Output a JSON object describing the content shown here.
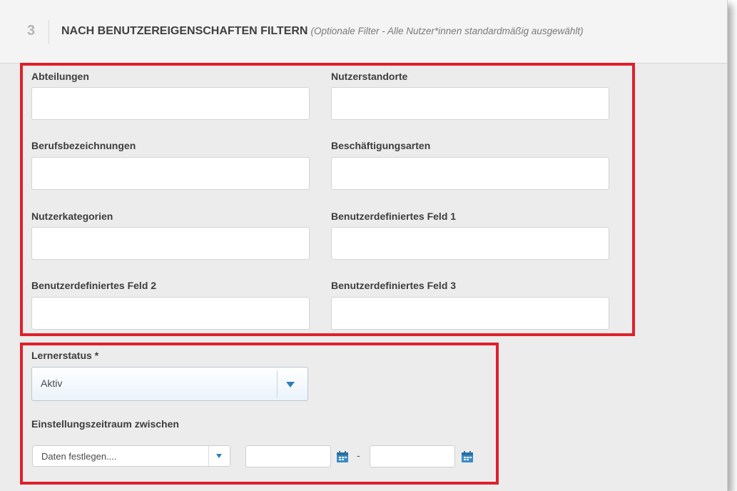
{
  "header": {
    "step_number": "3",
    "title": "NACH BENUTZEREIGENSCHAFTEN FILTERN",
    "subtitle": "(Optionale Filter - Alle Nutzer*innen standardmäßig ausgewählt)"
  },
  "filters": {
    "departments_label": "Abteilungen",
    "departments_value": "",
    "locations_label": "Nutzerstandorte",
    "locations_value": "",
    "job_titles_label": "Berufsbezeichnungen",
    "job_titles_value": "",
    "employment_types_label": "Beschäftigungsarten",
    "employment_types_value": "",
    "user_categories_label": "Nutzerkategorien",
    "user_categories_value": "",
    "custom_field_1_label": "Benutzerdefiniertes Feld 1",
    "custom_field_1_value": "",
    "custom_field_2_label": "Benutzerdefiniertes Feld 2",
    "custom_field_2_value": "",
    "custom_field_3_label": "Benutzerdefiniertes Feld 3",
    "custom_field_3_value": ""
  },
  "learner": {
    "status_label": "Lernerstatus *",
    "status_value": "Aktiv",
    "hire_period_label": "Einstellungszeitraum zwischen",
    "hire_period_select": "Daten festlegen....",
    "date_from": "",
    "date_to": "",
    "date_separator": "-"
  },
  "colors": {
    "highlight": "#e0202a",
    "accent": "#2f7fb6",
    "background": "#ececec"
  },
  "icons": {
    "status_dropdown": "chevron-down-icon",
    "period_dropdown": "chevron-down-icon",
    "date_picker": "calendar-icon"
  }
}
